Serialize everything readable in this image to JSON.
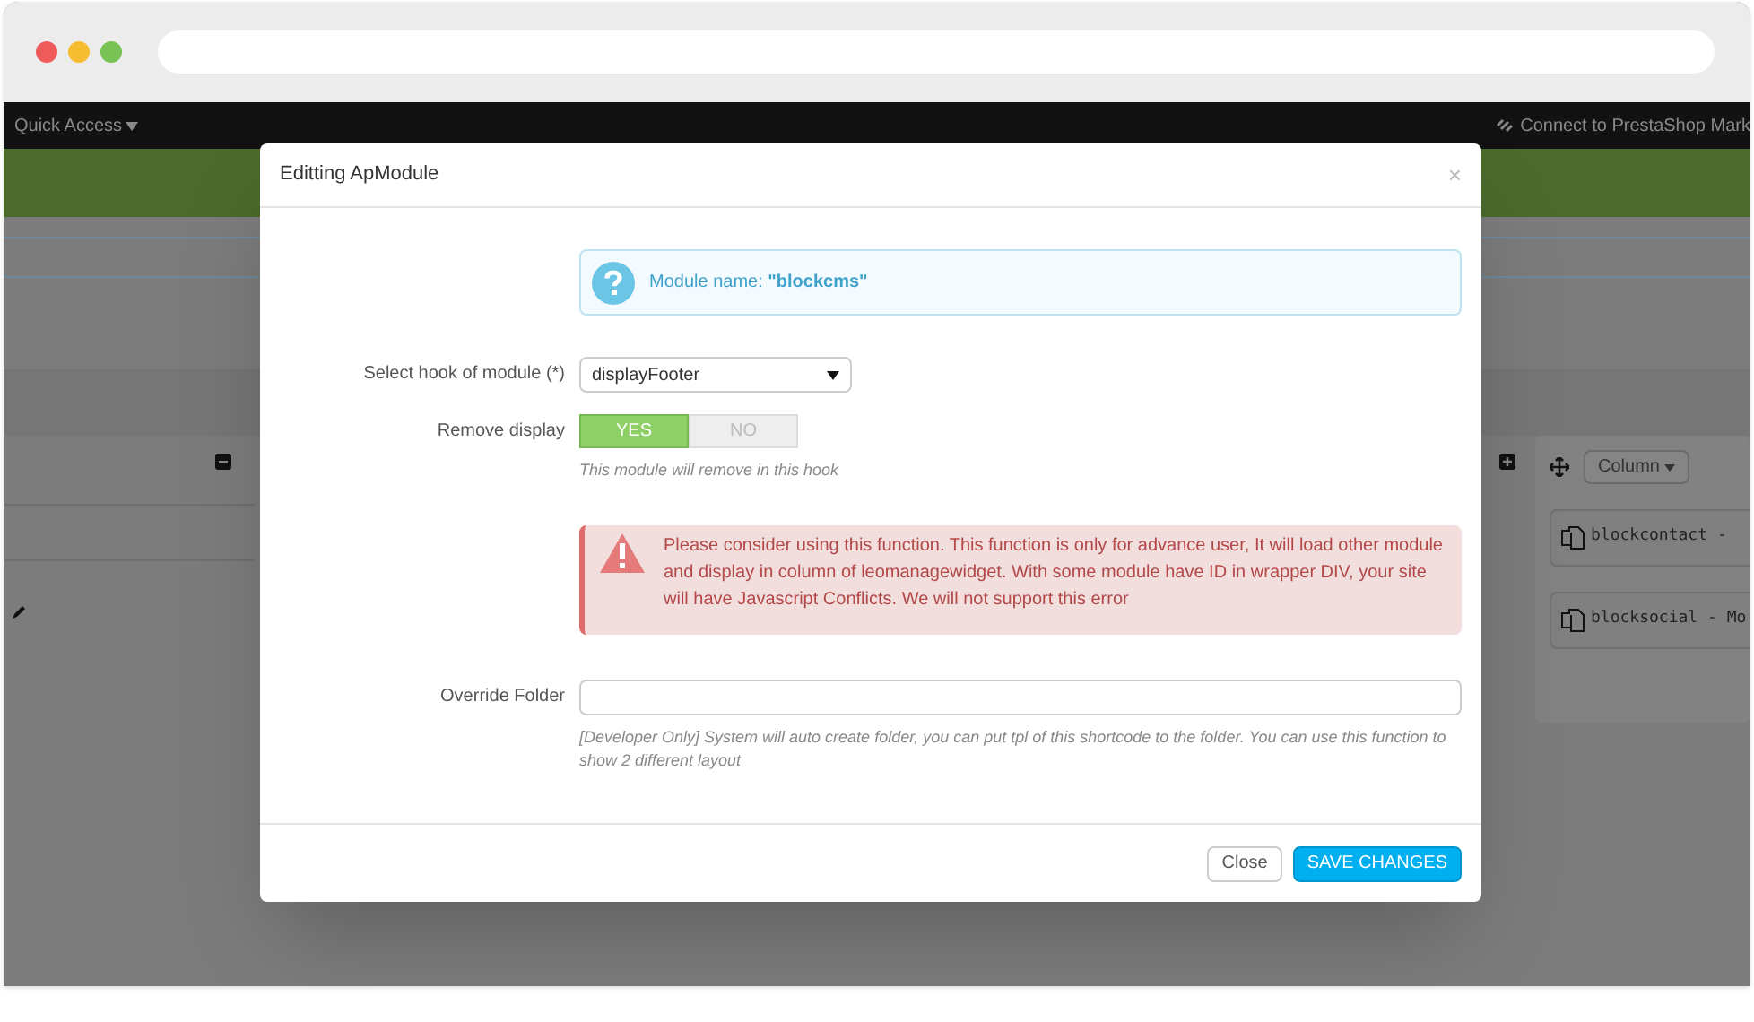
{
  "admin_bar": {
    "quick_access": "Quick Access",
    "connect": "Connect to PrestaShop Mark"
  },
  "column_panel": {
    "button": "Column",
    "modules": [
      "blockcontact -",
      "blocksocial - Mo"
    ]
  },
  "modal": {
    "title": "Editting ApModule",
    "close": "×",
    "info": "Module name: **\"blockcms\"**",
    "fields": [
      {
        "kind": "select",
        "label": "Select hook of module (*)",
        "value": "displayFooter"
      },
      {
        "kind": "toggle",
        "label": "Remove display",
        "options": [
          {
            "label": "YES",
            "selected": true
          },
          {
            "label": "NO",
            "selected": false
          }
        ],
        "help": "This module will remove in this hook"
      },
      {
        "kind": "alert",
        "text": "Please consider using this function. This function is only for advance user, It will load other module and display in column of leomanagewidget. With some module have ID in wrapper DIV, your site will have Javascript Conflicts. We will not support this error"
      },
      {
        "kind": "text",
        "label": "Override Folder",
        "help": "[Developer Only] System will auto create folder, you can put tpl of this shortcode to the folder. You can use this function to show 2 different layout"
      }
    ],
    "buttons": [
      {
        "label": "Close",
        "kind": "default"
      },
      {
        "label": "SAVE CHANGES",
        "kind": "primary"
      }
    ]
  }
}
